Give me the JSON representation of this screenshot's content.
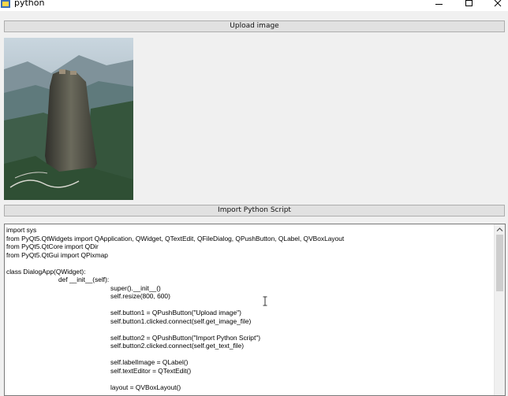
{
  "window": {
    "title": "python",
    "icon": "python-app-icon",
    "controls": [
      "minimize-icon",
      "maximize-icon",
      "close-icon"
    ]
  },
  "buttons": {
    "upload_label": "Upload image",
    "import_label": "Import Python Script"
  },
  "image_preview": {
    "icon": "mountain-photo"
  },
  "editor": {
    "lines": [
      {
        "indent": 0,
        "text": "import sys"
      },
      {
        "indent": 0,
        "text": "from PyQt5.QtWidgets import QApplication, QWidget, QTextEdit, QFileDialog, QPushButton, QLabel, QVBoxLayout"
      },
      {
        "indent": 0,
        "text": "from PyQt5.QtCore import QDir"
      },
      {
        "indent": 0,
        "text": "from PyQt5.QtGui import QPixmap"
      },
      {
        "indent": 0,
        "text": ""
      },
      {
        "indent": 0,
        "text": "class DialogApp(QWidget):"
      },
      {
        "indent": 1,
        "text": "def __init__(self):"
      },
      {
        "indent": 2,
        "text": "super().__init__()"
      },
      {
        "indent": 2,
        "text": "self.resize(800, 600)"
      },
      {
        "indent": 0,
        "text": ""
      },
      {
        "indent": 2,
        "text": "self.button1 = QPushButton(\"Upload image\")"
      },
      {
        "indent": 2,
        "text": "self.button1.clicked.connect(self.get_image_file)"
      },
      {
        "indent": 0,
        "text": ""
      },
      {
        "indent": 2,
        "text": "self.button2 = QPushButton(\"Import Python Script\")"
      },
      {
        "indent": 2,
        "text": "self.button2.clicked.connect(self.get_text_file)"
      },
      {
        "indent": 0,
        "text": ""
      },
      {
        "indent": 2,
        "text": "self.labelImage = QLabel()"
      },
      {
        "indent": 2,
        "text": "self.textEditor = QTextEdit()"
      },
      {
        "indent": 0,
        "text": ""
      },
      {
        "indent": 2,
        "text": "layout = QVBoxLayout()"
      }
    ],
    "scrollbar_icon": "scroll-up-arrow-icon"
  }
}
